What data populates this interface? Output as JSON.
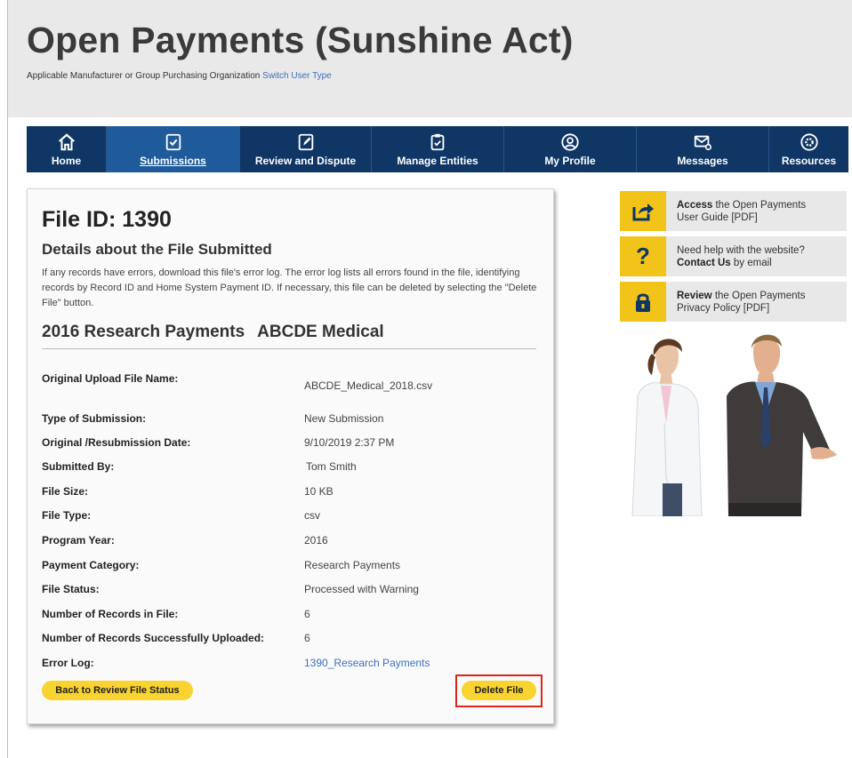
{
  "header": {
    "title": "Open Payments (Sunshine Act)",
    "user_type": "Applicable Manufacturer or Group Purchasing Organization",
    "switch_link": "Switch User Type"
  },
  "nav": [
    {
      "label": "Home",
      "icon": "home-icon"
    },
    {
      "label": "Submissions",
      "icon": "check-doc-icon",
      "active": true
    },
    {
      "label": "Review and Dispute",
      "icon": "edit-doc-icon"
    },
    {
      "label": "Manage Entities",
      "icon": "clipboard-icon"
    },
    {
      "label": "My Profile",
      "icon": "user-icon"
    },
    {
      "label": "Messages",
      "icon": "envelope-icon"
    },
    {
      "label": "Resources",
      "icon": "gear-icon"
    }
  ],
  "file": {
    "id_title": "File ID: 1390",
    "details_heading": "Details about the File Submitted",
    "details_text": "If any records have errors, download this file's error log. The error log lists all errors found in the file, identifying records by Record ID and Home System Payment ID. If necessary, this file can be deleted by selecting the \"Delete File\" button.",
    "heading_category": "2016 Research Payments",
    "heading_org": "ABCDE Medical",
    "fields": [
      {
        "label": "Original Upload File Name:",
        "value": "ABCDE_Medical_2018.csv"
      },
      {
        "label": "Type of Submission:",
        "value": "New Submission"
      },
      {
        "label": "Original /Resubmission Date:",
        "value": "9/10/2019 2:37 PM"
      },
      {
        "label": "Submitted By:",
        "value": "Tom Smith"
      },
      {
        "label": "File Size:",
        "value": "10 KB"
      },
      {
        "label": "File Type:",
        "value": "csv"
      },
      {
        "label": "Program Year:",
        "value": "2016"
      },
      {
        "label": "Payment Category:",
        "value": "Research Payments"
      },
      {
        "label": "File Status:",
        "value": "Processed with Warning"
      },
      {
        "label": "Number of Records in File:",
        "value": "6"
      },
      {
        "label": "Number of Records Successfully Uploaded:",
        "value": "6"
      },
      {
        "label": "Error Log:",
        "value": "1390_Research Payments"
      }
    ],
    "back_button": "Back to Review File Status",
    "delete_button": "Delete File"
  },
  "sidebar": [
    {
      "bold": "Access",
      "text_a": " the Open Payments",
      "text_b": "User Guide [PDF]",
      "icon": "share-arrow-icon"
    },
    {
      "bold": "Contact Us",
      "text_a": "Need help with the website?",
      "text_b": " by email",
      "icon": "question-icon"
    },
    {
      "bold": "Review",
      "text_a": " the Open Payments",
      "text_b": "Privacy Policy [PDF]",
      "icon": "lock-icon"
    }
  ],
  "colors": {
    "nav_bg": "#0f3664",
    "nav_active": "#1f5a9a",
    "button": "#f9d32f",
    "highlight": "#d9261c",
    "sidebar_icon": "#f2c318"
  }
}
